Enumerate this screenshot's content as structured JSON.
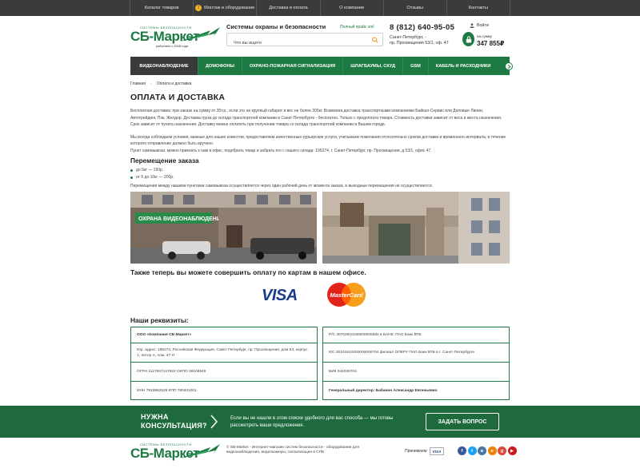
{
  "topnav": {
    "items": [
      {
        "label": "Каталог товаров",
        "badge": ""
      },
      {
        "label": "Монтаж и оборудование",
        "badge": "!"
      },
      {
        "label": "Доставка и оплата",
        "badge": ""
      },
      {
        "label": "О компании",
        "badge": ""
      },
      {
        "label": "Отзывы",
        "badge": ""
      },
      {
        "label": "Контакты",
        "badge": ""
      }
    ]
  },
  "header": {
    "logo_small": "СИСТЕМЫ БЕЗОПАСНОСТИ",
    "logo_main": "СБ-Маркет",
    "logo_since": "работаем с 2008 года",
    "tagline": "Системы охраны и безопасности",
    "price_link": "Полный прайс xml",
    "search_placeholder": "Что вы ищете",
    "phone": "8 (812) 640-95-05",
    "address_line1": "Санкт-Петербург, -",
    "address_line2": "пр. Просвещения 53/1, оф. 47",
    "login_label": "Войти",
    "cart_label": "на сумму",
    "cart_sum": "347 855₽"
  },
  "menu": {
    "items": [
      "ВИДЕОНАБЛЮДЕНИЕ",
      "ДОМОФОНЫ",
      "ОХРАНО-ПОЖАРНАЯ СИГНАЛИЗАЦИЯ",
      "ШЛАГБАУМЫ, СКУД",
      "GSM",
      "КАБЕЛЬ И РАСХОДНИКИ"
    ]
  },
  "breadcrumbs": {
    "home": "Главная",
    "separator": "›",
    "current": "Оплата и доставка"
  },
  "content": {
    "title": "ОПЛАТА И ДОСТАВКА",
    "p1": "Бесплатная доставка: при заказе на сумму от 30т.р., если это не крупный габарит и вес не более 300кг. Возможна доставка транспортными компаниями Байкал-Сервис или Деловые Линии, Автотрейдинг, Пэк, Желдор. Доставка груза до склада транспортной компании в Санкт-Петербурге - бесплатно. Только с предоплата товара. Стоимость доставки зависит от веса и места назначения. Срок зависит от пункта назначения. Доставку можно оплатить при получении товара со склада транспортной компании в Вашем городе.",
    "p2a": "Мы всегда соблюдаем условия, важные для наших клиентов, предоставляем качественные курьерские услуги, учитываем пожелания относительно сроков доставки и временного интервала, в течение которого отправление должно быть вручено.",
    "p2b": "Пункт самовывоза: можно приехать к нам в офис, подобрать товар и забрать его с нашего склада: 195274, г. Санкт-Петербург, пр. Просвещения, д 53/1, офис 47.",
    "subtitle": "Перемещение заказа",
    "bullets": [
      "до 5кг — 150р.",
      "от 5 до 10кг — 200р."
    ],
    "p3": "Перемещения между нашими пунктами самовывоза осуществляется через один рабочий день от момента заказа, в выходные перемещения не осуществляются.",
    "photo_sign": "ОХРАНА ВИДЕОНАБЛЮДЕНИЕ",
    "pay_title": "Также теперь вы можете совершить оплату по картам в нашем офисе.",
    "visa": "VISA",
    "mastercard": "MasterCard"
  },
  "requisites": {
    "title": "Наши реквизиты:",
    "left": [
      "ООО «Компания СБ-Маркет»",
      "Юр. адрес: 195274, Российская Федерация, Санкт-Петербург, пр. Просвещения, дом 53, корпус 1, литер А, пом. 47-Н",
      "ОГРН 1127847147922 ОКПО 38109946",
      "ИНН 7810862526 КПП 780401001"
    ],
    "right": [
      "Р/С 40702810180000005582 в БАНК: ПАО Банк ВТБ",
      "К/С 30101810200000000704 филиал ОПЕРУ ПАО Банк ВТБ в г. Санкт-Петербурге",
      "БИК 044030704",
      "Генеральный директор: Бабанин Александр Евгеньевич"
    ]
  },
  "banner": {
    "title_line1": "НУЖНА",
    "title_line2": "КОНСУЛЬТАЦИЯ?",
    "text": "Если вы не нашли в этом списке удобного для вас способа — мы готовы рассмотреть ваши предложения.",
    "button": "ЗАДАТЬ ВОПРОС"
  },
  "footer": {
    "text": "© SB-Market - Интернет-магазин систем безопасности - оборудование для видеонаблюдения, видеокамеры, сигнализация в СПБ",
    "pay_label": "Принимаем:",
    "visa": "VISA",
    "socials": [
      {
        "name": "facebook",
        "glyph": "f",
        "color": "#3b5998"
      },
      {
        "name": "twitter",
        "glyph": "t",
        "color": "#1da1f2"
      },
      {
        "name": "vk",
        "glyph": "в",
        "color": "#4a76a8"
      },
      {
        "name": "odnoklassniki",
        "glyph": "о",
        "color": "#ee8208"
      },
      {
        "name": "google-plus",
        "glyph": "g",
        "color": "#dd4b39"
      },
      {
        "name": "youtube",
        "glyph": "▶",
        "color": "#cc181e"
      }
    ]
  },
  "colors": {
    "brand_green": "#1e7a43",
    "dark_bar": "#3b3b3b",
    "banner_green": "#1e6a3d"
  }
}
